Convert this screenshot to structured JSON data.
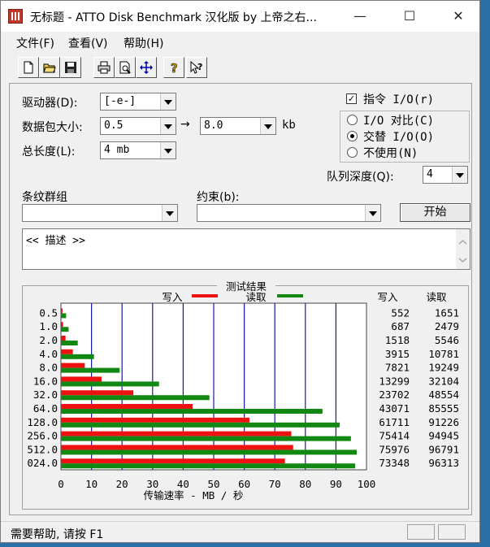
{
  "window": {
    "title": "无标题 - ATTO Disk Benchmark  汉化版 by 上帝之右...",
    "minimize_glyph": "—",
    "maximize_glyph": "☐",
    "close_glyph": "✕"
  },
  "menu": [
    "文件(F)",
    "查看(V)",
    "帮助(H)"
  ],
  "toolbar": {
    "icons": [
      "new-file-icon",
      "open-folder-icon",
      "save-icon",
      "print-icon",
      "print-preview-icon",
      "move-icon",
      "help-icon",
      "context-help-icon"
    ]
  },
  "form": {
    "drive_label": "驱动器(D):",
    "drive_value": "[-e-]",
    "transfer_label": "数据包大小:",
    "transfer_from": "0.5",
    "arrow": "→",
    "transfer_to": "8.0",
    "transfer_unit": "kb",
    "total_label": "总长度(L):",
    "total_value": "4 mb",
    "direct_io_label": "指令 I/O(r)",
    "direct_io_checked": true,
    "radio_compare_label": "I/O 对比(C)",
    "radio_overlap_label": "交替 I/O(O)",
    "radio_neither_label": "不使用(N)",
    "selected_radio": "overlap",
    "queue_label": "队列深度(Q):",
    "queue_value": "4",
    "stripe_label": "条纹群组",
    "stripe_value": "",
    "constraint_label": "约束(b):",
    "constraint_value": "",
    "start_button": "开始",
    "description_text": "<< 描述 >>"
  },
  "results": {
    "group_title": "测试结果",
    "write_legend": "写入",
    "read_legend": "读取",
    "write_header": "写入",
    "read_header": "读取",
    "x_axis_label": "传输速率 - MB / 秒",
    "write_color": "#ee1111",
    "read_color": "#118811",
    "grid_color": "#1a1aaa"
  },
  "chart_data": {
    "type": "bar",
    "orientation": "horizontal",
    "categories": [
      "0.5",
      "1.0",
      "2.0",
      "4.0",
      "8.0",
      "16.0",
      "32.0",
      "64.0",
      "128.0",
      "256.0",
      "512.0",
      "024.0"
    ],
    "series": [
      {
        "name": "写入",
        "values": [
          0.5,
          0.7,
          1.5,
          3.9,
          7.8,
          13.3,
          23.7,
          43.1,
          61.7,
          75.4,
          76.0,
          73.3
        ],
        "display": [
          "552",
          "687",
          "1518",
          "3915",
          "7821",
          "13299",
          "23702",
          "43071",
          "61711",
          "75414",
          "75976",
          "73348"
        ]
      },
      {
        "name": "读取",
        "values": [
          1.7,
          2.5,
          5.5,
          10.8,
          19.2,
          32.1,
          48.6,
          85.6,
          91.2,
          94.9,
          96.8,
          96.3
        ],
        "display": [
          "1651",
          "2479",
          "5546",
          "10781",
          "19249",
          "32104",
          "48554",
          "85555",
          "91226",
          "94945",
          "96791",
          "96313"
        ]
      }
    ],
    "x_ticks": [
      "0",
      "10",
      "20",
      "30",
      "40",
      "50",
      "60",
      "70",
      "80",
      "90",
      "100"
    ],
    "xlim": [
      0,
      100
    ],
    "xlabel": "传输速率 - MB / 秒",
    "grid": true
  },
  "status": {
    "text": "需要帮助, 请按 F1"
  }
}
